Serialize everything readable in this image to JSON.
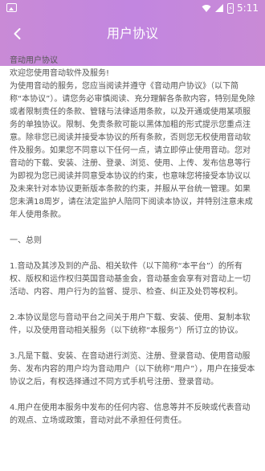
{
  "status_bar": {
    "time": "5:11",
    "icons": [
      "app-icon",
      "wifi-icon",
      "signal-icon",
      "battery-charging-icon"
    ]
  },
  "nav": {
    "title": "用户协议",
    "back_icon": "chevron-left-icon"
  },
  "content": {
    "heading": "音动用户协议",
    "welcome": "欢迎您使用音动软件及服务!",
    "intro": "为使用音动的服务，您应当阅读并遵守《音动用户协议》（以下简称“本协议”）。请您务必审慎阅读、充分理解各条款内容，特别是免除或者限制责任的条款、管辖与法律适用条款，以及开通或使用某项服务的单独协议。限制、免责条款可能以黑体加粗的形式提示您重点注意。除非您已阅读并接受本协议的所有条款，否则您无权使用音动软件及服务。如果您不同意以下任何一点，请立即停止使用音动。您对音动的下载、安装、注册、登录、浏览、使用、上传、发布信息等行为即视为您已阅读并同意受本协议的约束，也意味您将接受本协议以及未来针对本协议更新版本条款的约束，并服从平台统一管理。如果您未满18周岁，请在法定监护人陪同下阅读本协议，并特别注意未成年人使用条款。",
    "section_title": "一、总则",
    "clause1": "1.音动及其涉及到的产品、相关软件（以下简称“本平台”）的所有权、版权和运作权归英国音动基金会，音动基金会享有对音动上一切活动、内容、用户行为的监督、提示、检查、纠正及处罚等权利。",
    "clause2": "2.本协议是您与音动平台之间关于用户下载、安装、使用、复制本软件，以及使用音动相关服务（以下统称“本服务”）所订立的协议。",
    "clause3": "3.凡是下载、安装、在音动进行浏览、注册、登录音动、使用音动服务、发布内容的用户均为音动用户（以下统称“用户”），用户在接受本协议之后，有权选择通过不同方式手机号注册、登录音动。",
    "clause4": "4.用户在使用本服务中发布的任何内容、信息等并不反映或代表音动的观点、立场或政策，音动对此不承担任何责任。"
  }
}
